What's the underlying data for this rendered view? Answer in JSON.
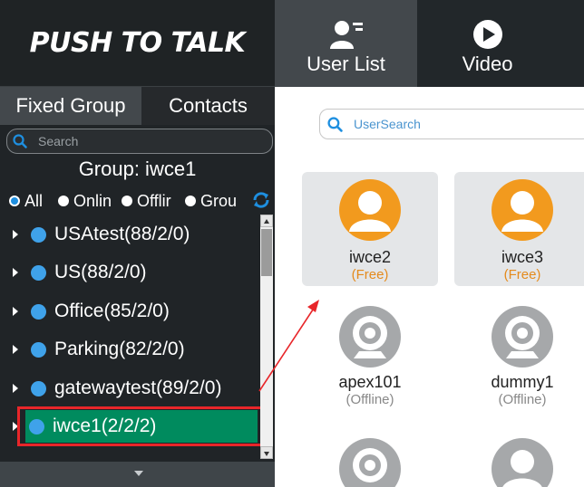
{
  "app": {
    "title": "PUSH TO TALK"
  },
  "left_tabs": [
    "Fixed Group",
    "Contacts"
  ],
  "left_search": {
    "placeholder": "Search"
  },
  "group": {
    "label": "Group:  iwce1"
  },
  "filters": [
    {
      "label": "All",
      "selected": true
    },
    {
      "label": "Onlin",
      "selected": false
    },
    {
      "label": "Offlir",
      "selected": false
    },
    {
      "label": "Grou",
      "selected": false
    }
  ],
  "groups": [
    {
      "label": "USAtest(88/2/0)"
    },
    {
      "label": "US(88/2/0)"
    },
    {
      "label": "Office(85/2/0)"
    },
    {
      "label": "Parking(82/2/0)"
    },
    {
      "label": "gatewaytest(89/2/0)"
    },
    {
      "label": "iwce1(2/2/2)",
      "selected": true
    }
  ],
  "nav": [
    {
      "label": "User List",
      "icon": "user-list-icon",
      "active": true
    },
    {
      "label": "Video",
      "icon": "play-icon",
      "active": false
    }
  ],
  "user_search": {
    "placeholder": "UserSearch"
  },
  "users": [
    {
      "name": "iwce2",
      "status": "(Free)",
      "online": true
    },
    {
      "name": "iwce3",
      "status": "(Free)",
      "online": true
    },
    {
      "name": "apex101",
      "status": "(Offline)",
      "online": false,
      "icon": "camera-icon"
    },
    {
      "name": "dummy1",
      "status": "(Offline)",
      "online": false,
      "icon": "camera-icon"
    }
  ],
  "colors": {
    "accent_blue": "#1e8fe0",
    "selected_group": "#008b5e",
    "highlight_red": "#e8262a",
    "free_status": "#e48a1c",
    "avatar_orange": "#f29a1e"
  }
}
